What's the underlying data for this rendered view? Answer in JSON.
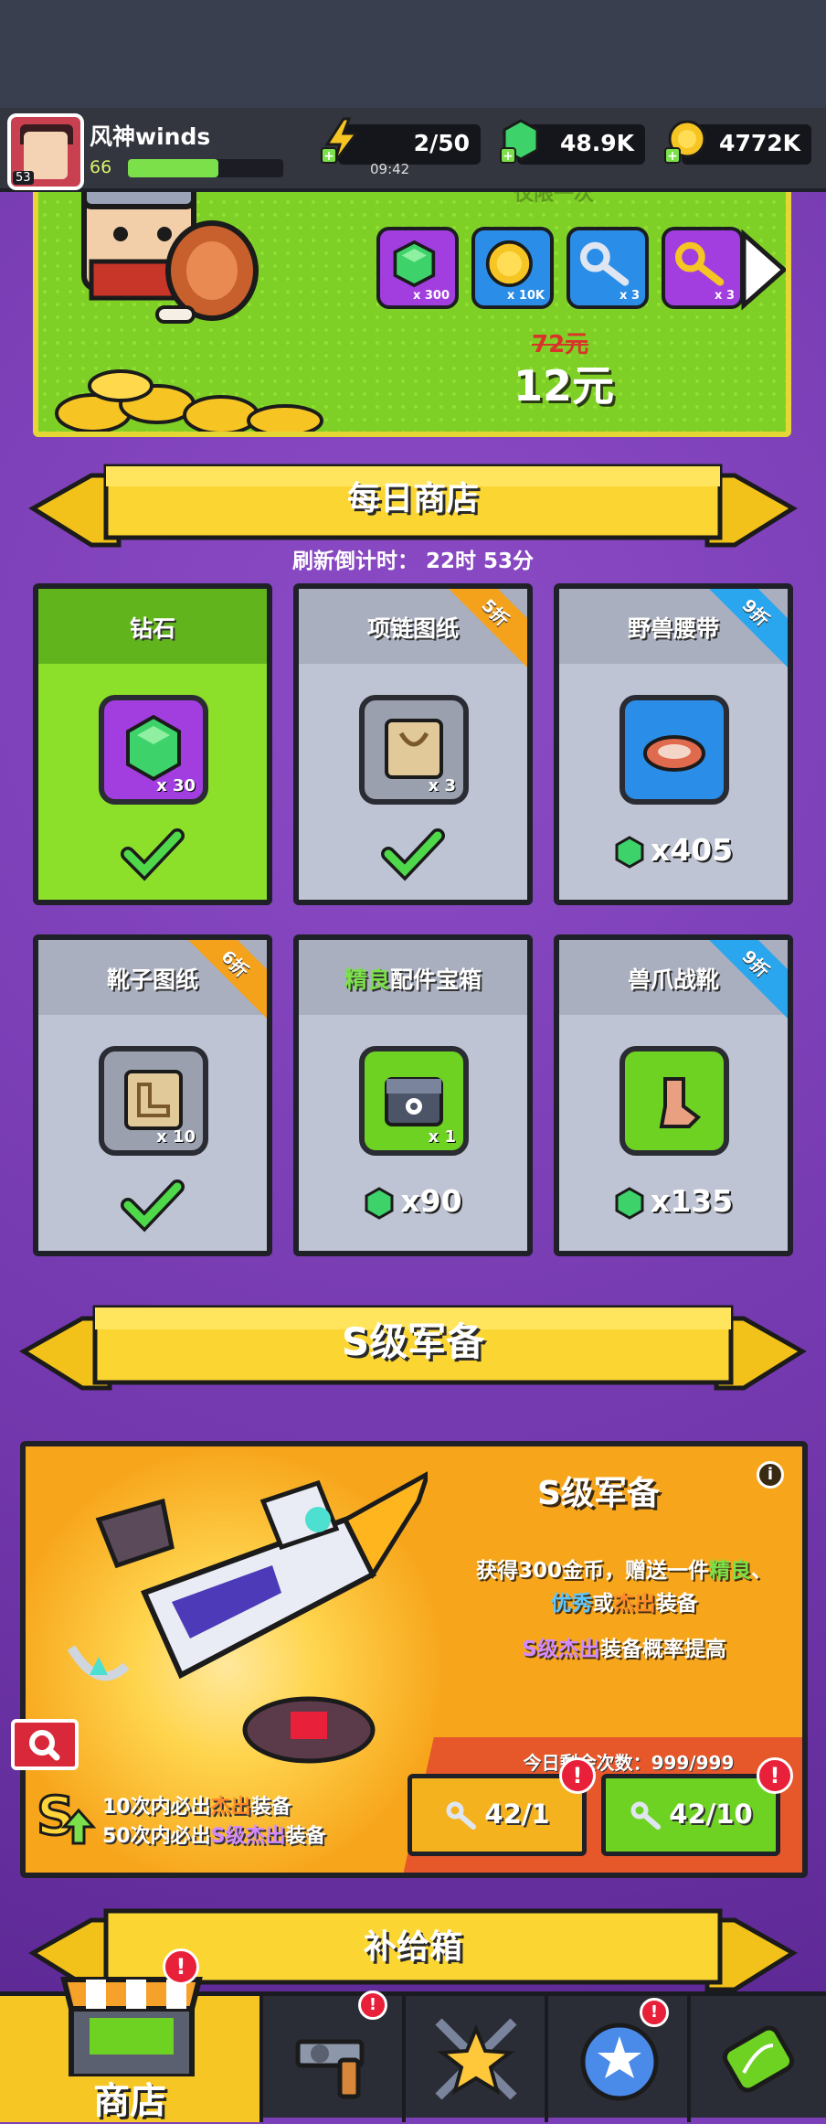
{
  "player": {
    "name": "风神winds",
    "level": "66",
    "avatar_level": "53",
    "xp_progress": 0.58
  },
  "resources": {
    "energy": "2/50",
    "energy_timer": "09:42",
    "gems": "48.9K",
    "coins": "4772K"
  },
  "offer": {
    "title": "仅限一次",
    "items": [
      {
        "qty": "x 300",
        "icon": "gem-icon",
        "color": "#a23ee0"
      },
      {
        "qty": "x 10K",
        "icon": "coin-icon",
        "color": "#2a8ee8"
      },
      {
        "qty": "x 3",
        "icon": "silver-key-icon",
        "color": "#2a8ee8"
      },
      {
        "qty": "x 3",
        "icon": "gold-key-icon",
        "color": "#a23ee0"
      }
    ],
    "old_price": "72元",
    "price": "12元"
  },
  "daily_shop": {
    "title": "每日商店",
    "refresh": "刷新倒计时： 22时 53分",
    "cards": [
      {
        "name": "钻石",
        "qty": "x 30",
        "icon": "gem-icon",
        "purchased": true,
        "tag": "",
        "cost": ""
      },
      {
        "name": "项链图纸",
        "qty": "x 3",
        "icon": "necklace-blueprint-icon",
        "purchased": true,
        "tag": "5折",
        "cost": ""
      },
      {
        "name": "野兽腰带",
        "qty": "",
        "icon": "beast-belt-icon",
        "purchased": false,
        "tag": "9折",
        "cost": "x405"
      },
      {
        "name": "靴子图纸",
        "qty": "x 10",
        "icon": "boots-blueprint-icon",
        "purchased": true,
        "tag": "6折",
        "cost": ""
      },
      {
        "name": "配件宝箱",
        "name_prefix": "精良",
        "qty": "x 1",
        "icon": "accessory-chest-icon",
        "purchased": false,
        "tag": "",
        "cost": "x90"
      },
      {
        "name": "兽爪战靴",
        "qty": "",
        "icon": "claw-boots-icon",
        "purchased": false,
        "tag": "9折",
        "cost": "x135"
      }
    ]
  },
  "s_section": {
    "ribbon": "S级军备",
    "title": "S级军备",
    "desc_line1": "获得300金币，赠送一件",
    "desc_good": "精良",
    "desc_sep": "、",
    "desc_excellent": "优秀",
    "desc_or": "或",
    "desc_outstanding": "杰出",
    "desc_end": "装备",
    "desc2_s": "S级杰出",
    "desc2_rest": "装备概率提高",
    "guarantee1_a": "10次内必出",
    "guarantee1_b": "杰出",
    "guarantee1_c": "装备",
    "guarantee2_a": "50次内必出",
    "guarantee2_b": "S级杰出",
    "guarantee2_c": "装备",
    "remaining": "今日剩余次数：999/999",
    "btn1": "42/1",
    "btn2": "42/10"
  },
  "supply": {
    "ribbon": "补给箱"
  },
  "nav": {
    "shop": "商店"
  },
  "colors": {
    "purple_bg": "#7b3fb8",
    "green_card": "#8de02a",
    "gem": "#3ed36a"
  }
}
